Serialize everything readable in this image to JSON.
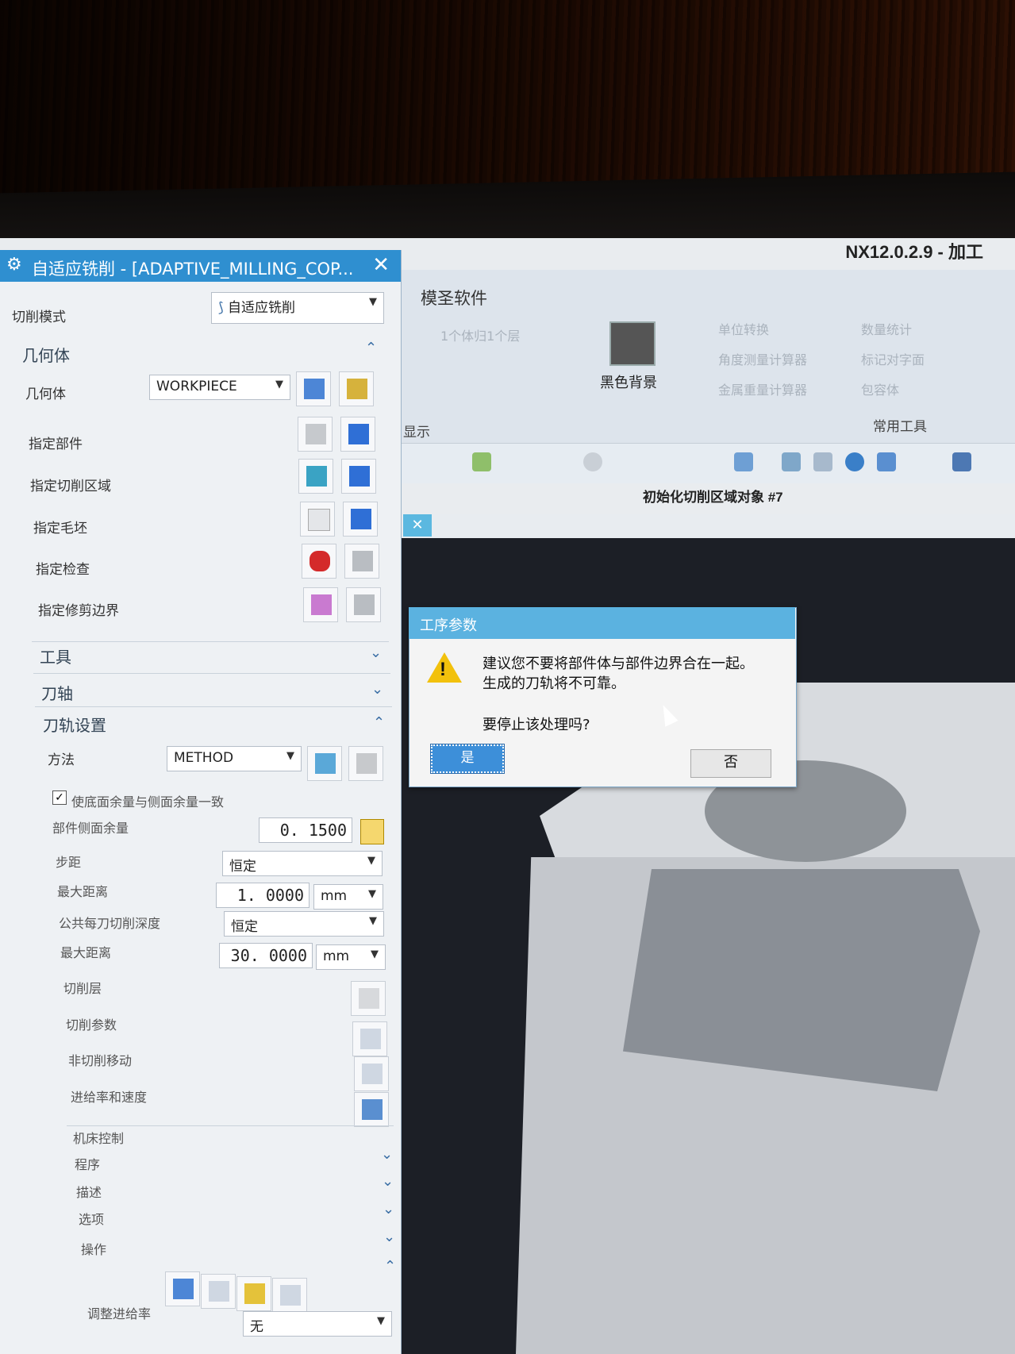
{
  "app_title": "NX12.0.2.9 - 加工",
  "ribbon": {
    "tab": "模圣软件",
    "black_bg": "黑色背景",
    "group_display": "显示",
    "group_tools": "常用工具",
    "faded_items": [
      "单位转换",
      "数量统计",
      "角度测量计算器",
      "标记对字面",
      "金属重量计算器",
      "包容体",
      "1个体归1个层"
    ]
  },
  "status": "初始化切削区域对象 #7",
  "dialog": {
    "title": "自适应铣削 - [ADAPTIVE_MILLING_COP...",
    "cut_mode_label": "切削模式",
    "cut_mode_value": "自适应铣削",
    "geometry_section": "几何体",
    "geometry_label": "几何体",
    "geometry_value": "WORKPIECE",
    "specify_part": "指定部件",
    "specify_cut_area": "指定切削区域",
    "specify_blank": "指定毛坯",
    "specify_check": "指定检查",
    "specify_trim": "指定修剪边界",
    "tool_section": "工具",
    "axis_section": "刀轴",
    "path_section": "刀轨设置",
    "method_label": "方法",
    "method_value": "METHOD",
    "floor_side_check": "使底面余量与侧面余量一致",
    "part_side_stock": "部件侧面余量",
    "part_side_stock_value": "0. 1500",
    "stepover": "步距",
    "stepover_value": "恒定",
    "max_distance": "最大距离",
    "max_distance_value": "1. 0000",
    "unit_mm": "mm",
    "depth_per_cut": "公共每刀切削深度",
    "depth_value": "恒定",
    "max_distance2": "最大距离",
    "max_distance2_value": "30. 0000",
    "unit_mm2": "mm",
    "cut_levels": "切削层",
    "cut_params": "切削参数",
    "non_cut_moves": "非切削移动",
    "feeds_speeds": "进给率和速度",
    "machine_control": "机床控制",
    "program": "程序",
    "description": "描述",
    "options": "选项",
    "actions": "操作",
    "adjust_feed": "调整进给率",
    "adjust_feed_value": "无"
  },
  "warning": {
    "title": "工序参数",
    "line1": "建议您不要将部件体与部件边界合在一起。",
    "line2": "生成的刀轨将不可靠。",
    "line3": "要停止该处理吗?",
    "yes": "是",
    "no": "否"
  }
}
